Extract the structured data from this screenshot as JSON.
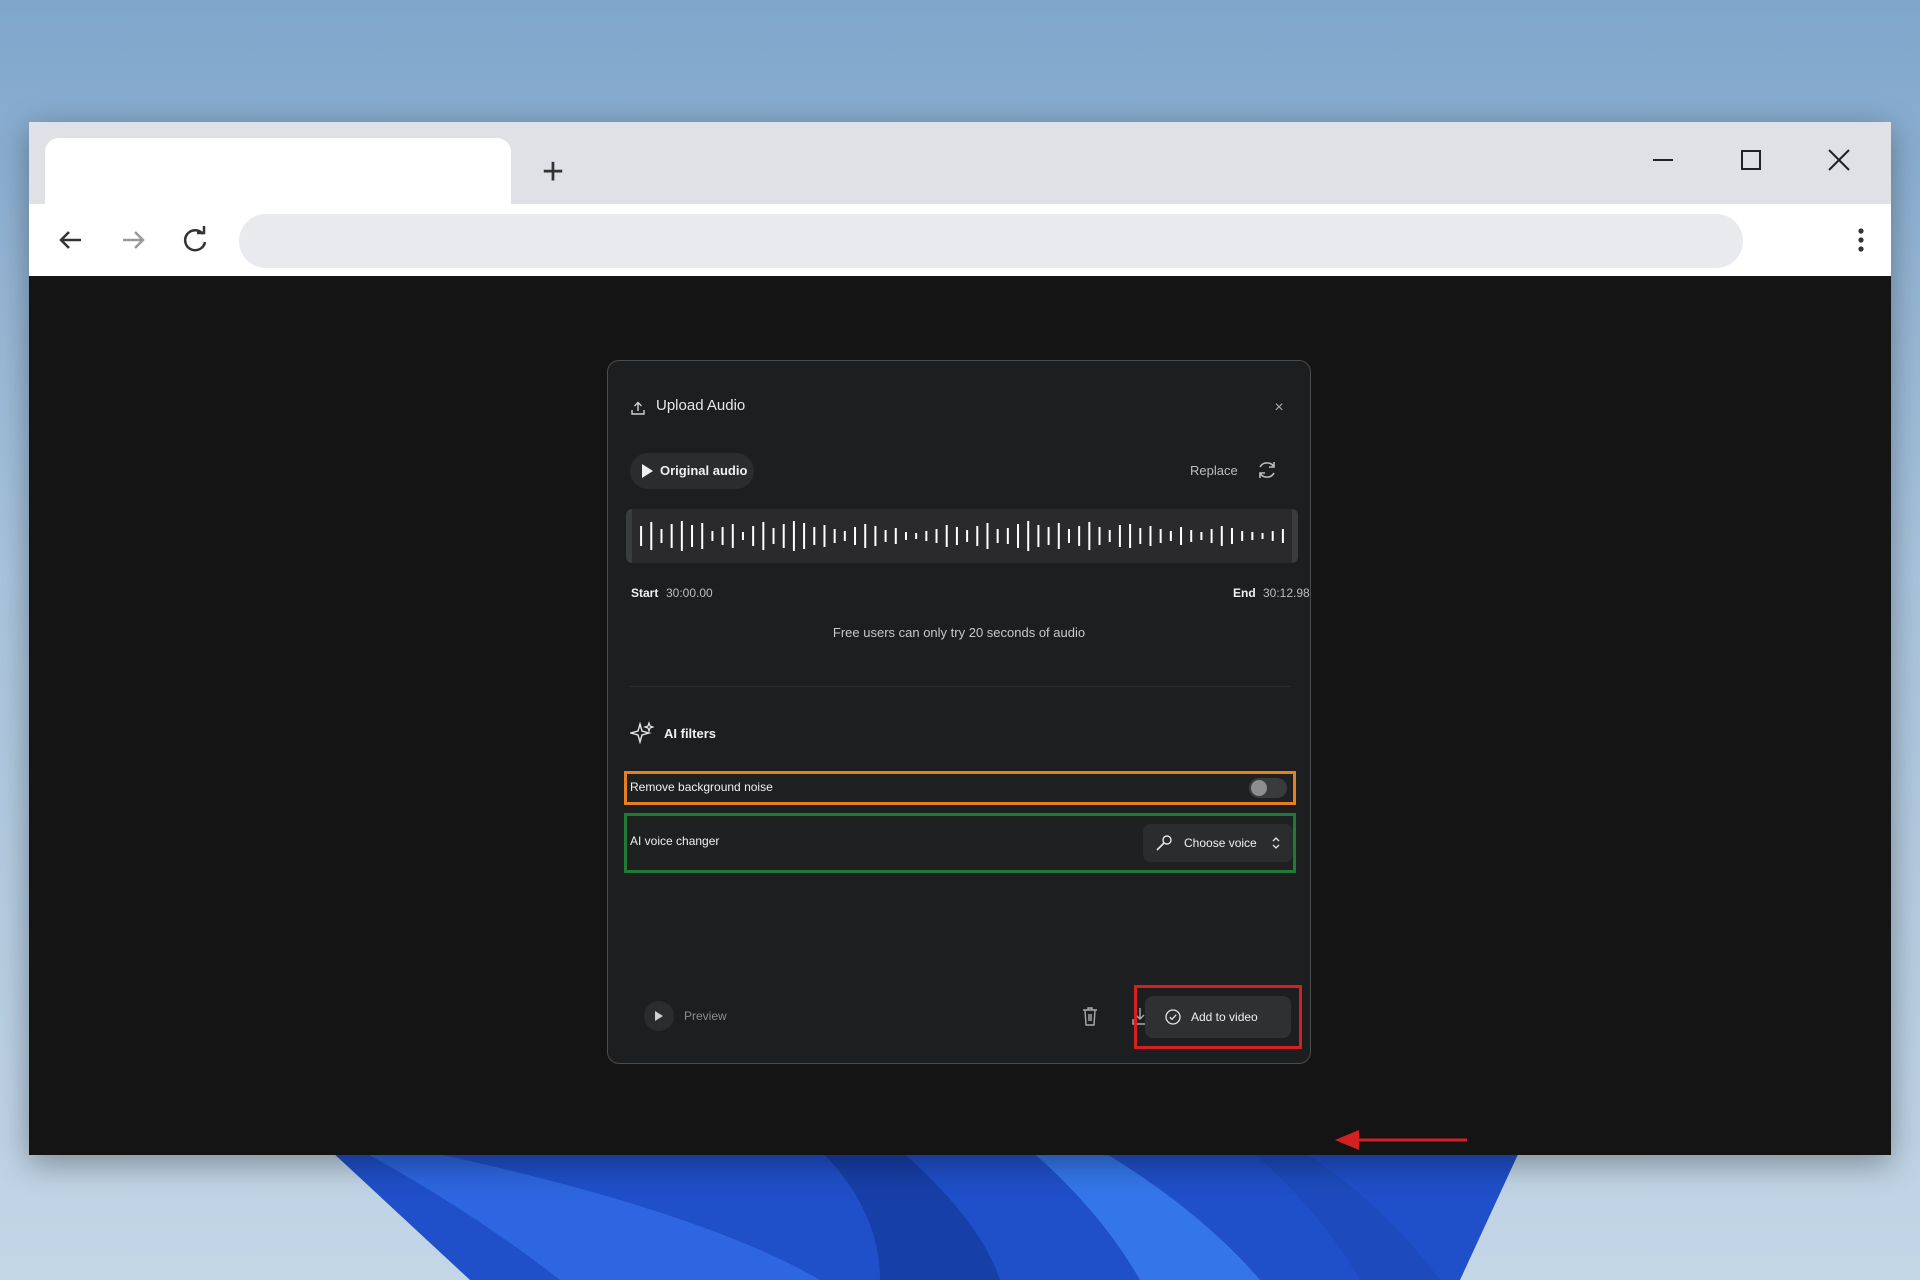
{
  "browser": {
    "new_tab_label": "+",
    "window_controls": [
      "minimize-icon",
      "maximize-icon",
      "close-icon"
    ],
    "nav_icons": [
      "back-arrow-icon",
      "forward-arrow-icon",
      "reload-icon",
      "kebab-menu-icon"
    ]
  },
  "dialog": {
    "title": "Upload Audio",
    "close_label": "×",
    "original_audio_label": "Original audio",
    "replace_label": "Replace",
    "start_label": "Start",
    "start_time": "30:00.00",
    "end_label": "End",
    "end_time": "30:12.98",
    "free_note": "Free users can only try 20 seconds of audio",
    "ai_filters_title": "AI filters",
    "remove_noise_label": "Remove background noise",
    "remove_noise_enabled": false,
    "voice_changer_label": "AI voice changer",
    "choose_voice_label": "Choose voice",
    "preview_label": "Preview",
    "add_to_video_label": "Add to video"
  },
  "colors": {
    "noise_highlight": "#e67e22",
    "voice_highlight": "#1e7a35",
    "add_highlight": "#d32020",
    "dialog_bg": "#1d1e1f"
  }
}
